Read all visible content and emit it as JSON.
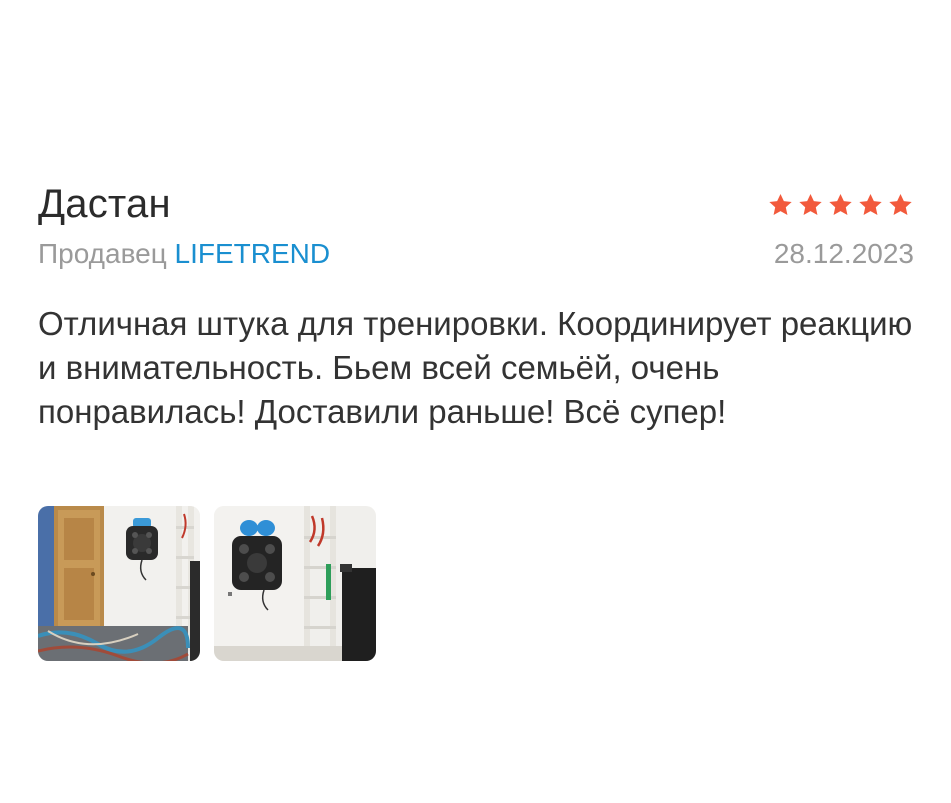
{
  "review": {
    "author": "Дастан",
    "rating": 5,
    "rating_max": 5,
    "star_color": "#f25a3c",
    "seller_prefix": "Продавец",
    "seller_name": "LIFETREND",
    "date": "28.12.2023",
    "text": "Отличная штука для тренировки. Координирует реакцию и внимательность. Бьем всей семьёй, очень понравилась! Доставили раньше! Всё супер!",
    "photos": [
      {
        "name": "review-photo-1"
      },
      {
        "name": "review-photo-2"
      }
    ]
  },
  "colors": {
    "link": "#1a8fd0",
    "muted": "#9a9a9a",
    "text": "#333333"
  }
}
